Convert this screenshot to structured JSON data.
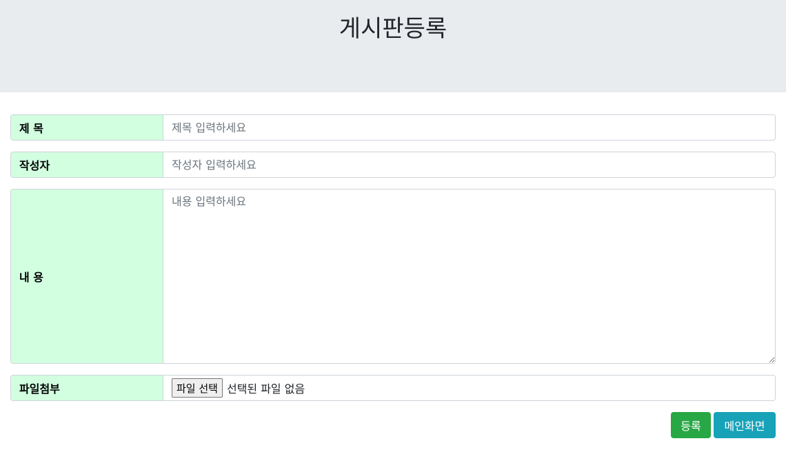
{
  "header": {
    "title": "게시판등록"
  },
  "form": {
    "title_label": "제 목",
    "title_placeholder": "제목 입력하세요",
    "writer_label": "작성자",
    "writer_placeholder": "작성자 입력하세요",
    "content_label": "내 용",
    "content_placeholder": "내용 입력하세요",
    "file_label": "파일첨부",
    "file_button": "파일 선택",
    "file_status": "선택된 파일 없음"
  },
  "actions": {
    "register_label": "등록",
    "main_label": "메인화면"
  },
  "colors": {
    "header_bg": "#e9ecef",
    "label_bg": "#d1ffe0",
    "register_btn": "#28a745",
    "main_btn": "#17a2b8"
  }
}
